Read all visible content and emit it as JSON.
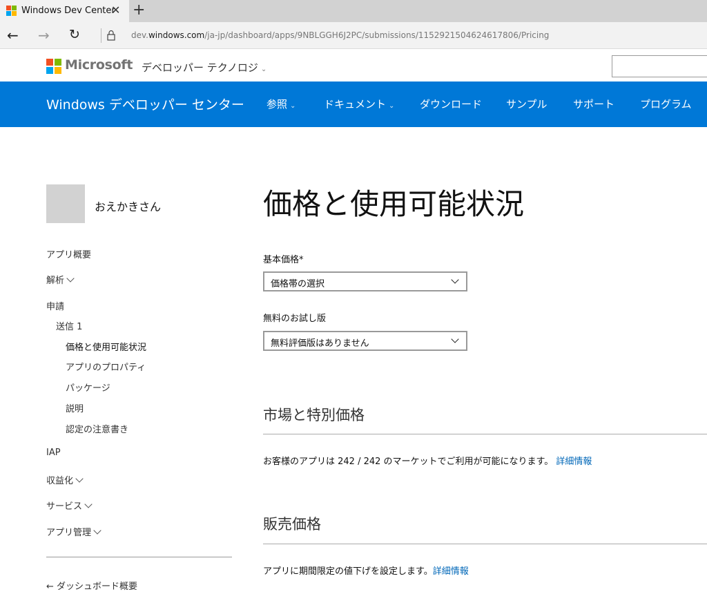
{
  "browser": {
    "tab_title": "Windows Dev Center",
    "url_prefix": "dev.",
    "url_domain": "windows.com",
    "url_path": "/ja-jp/dashboard/apps/9NBLGGH6J2PC/submissions/1152921504624617806/Pricing"
  },
  "ms_header": {
    "brand": "Microsoft",
    "dev_tech": "デベロッパー テクノロジ"
  },
  "blue_nav": {
    "site_title": "Windows デベロッパー センター",
    "items": [
      "参照",
      "ドキュメント",
      "ダウンロード",
      "サンプル",
      "サポート",
      "プログラム"
    ]
  },
  "sidebar": {
    "user_name": "おえかきさん",
    "app_overview": "アプリ概要",
    "analytics": "解析",
    "submission": "申請",
    "submission_1": "送信 1",
    "pricing": "価格と使用可能状況",
    "properties": "アプリのプロパティ",
    "packages": "パッケージ",
    "description": "説明",
    "cert_notes": "認定の注意書き",
    "iap": "IAP",
    "monetization": "収益化",
    "services": "サービス",
    "app_management": "アプリ管理",
    "dashboard_overview": "ダッシュボード概要"
  },
  "main": {
    "title": "価格と使用可能状況",
    "base_price_label": "基本価格*",
    "base_price_value": "価格帯の選択",
    "free_trial_label": "無料のお試し版",
    "free_trial_value": "無料評価版はありません",
    "markets_title": "市場と特別価格",
    "markets_text": "お客様のアプリは 242 / 242 のマーケットでご利用が可能になります。",
    "details_link": "詳細情報",
    "sale_title": "販売価格",
    "sale_text": "アプリに期間限定の値下げを設定します。"
  },
  "colors": {
    "nav_blue": "#0078d7",
    "link_blue": "#0067b8"
  }
}
